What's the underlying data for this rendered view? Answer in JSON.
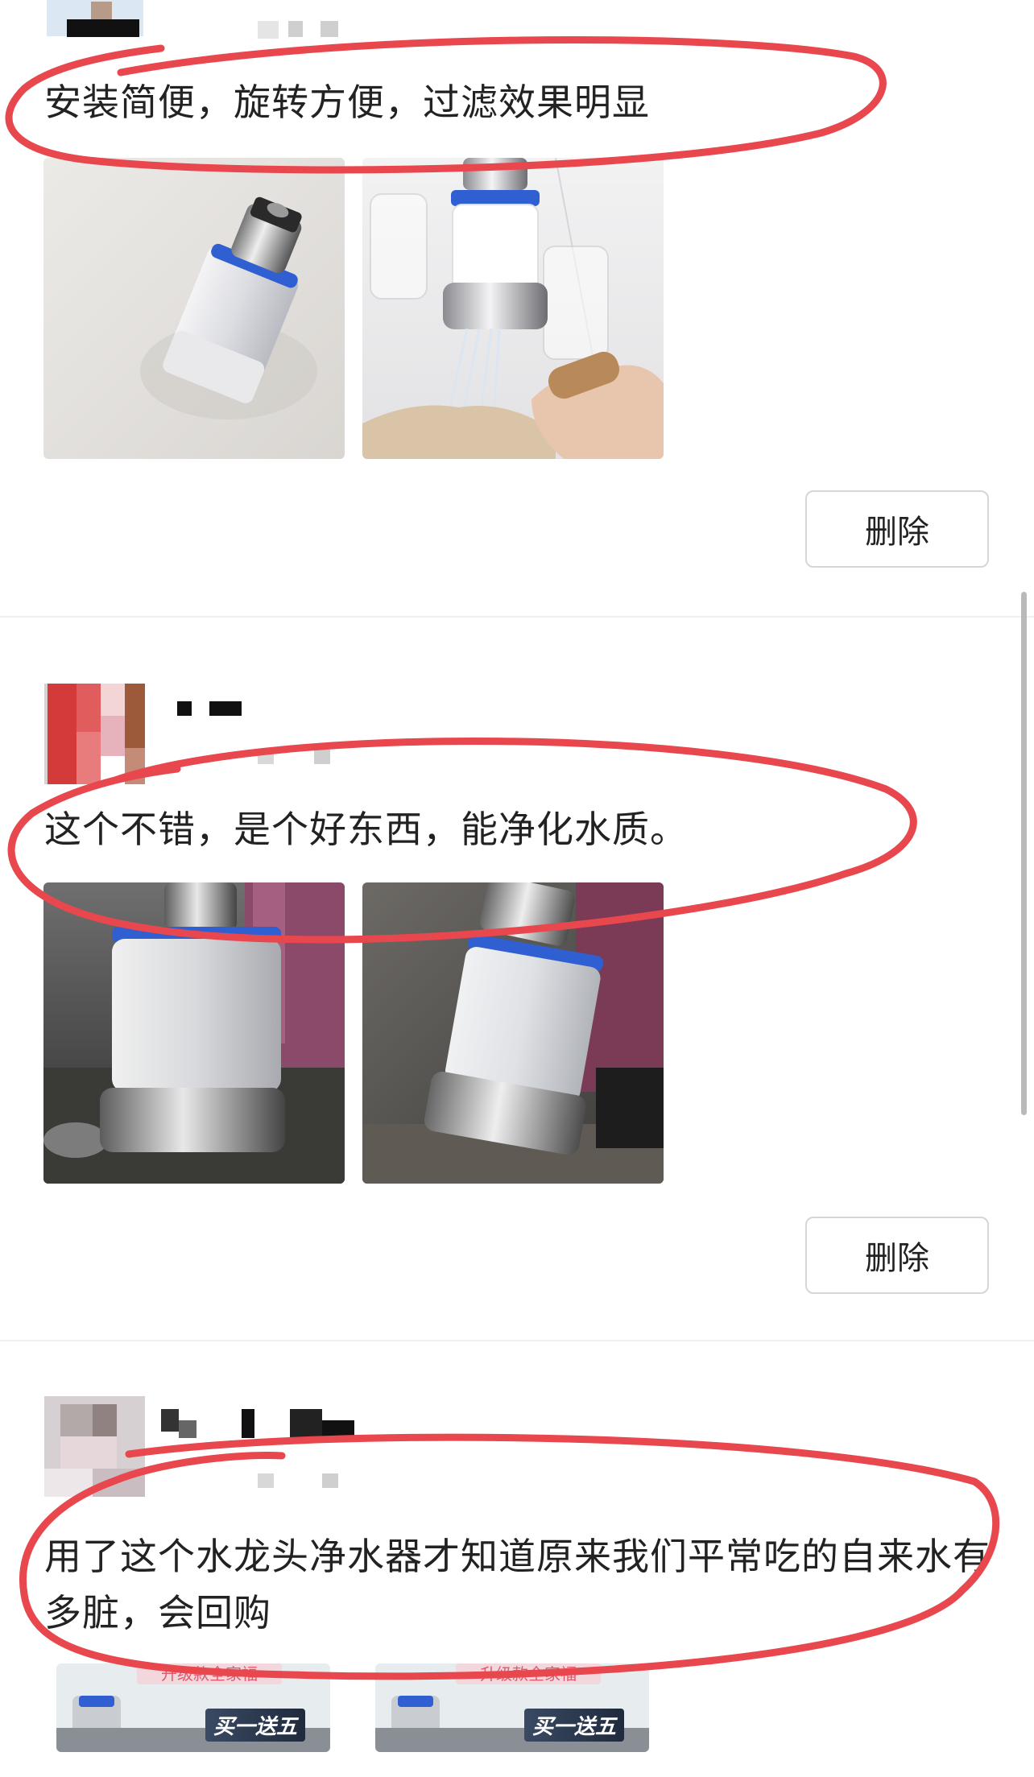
{
  "reviews": [
    {
      "comment": "安装简便，旋转方便，过滤效果明显",
      "delete_label": "删除"
    },
    {
      "comment": "这个不错，是个好东西，能净化水质。",
      "delete_label": "删除"
    },
    {
      "comment": "用了这个水龙头净水器才知道原来我们平常吃的自来水有多脏，会回购",
      "promo_tag": "买一送五"
    }
  ],
  "colors": {
    "annotation_ring": "#e8474d",
    "filter_blue": "#2f5fd0",
    "chrome": "#c8c8cc"
  },
  "icons": [
    "mosaic-blur"
  ]
}
